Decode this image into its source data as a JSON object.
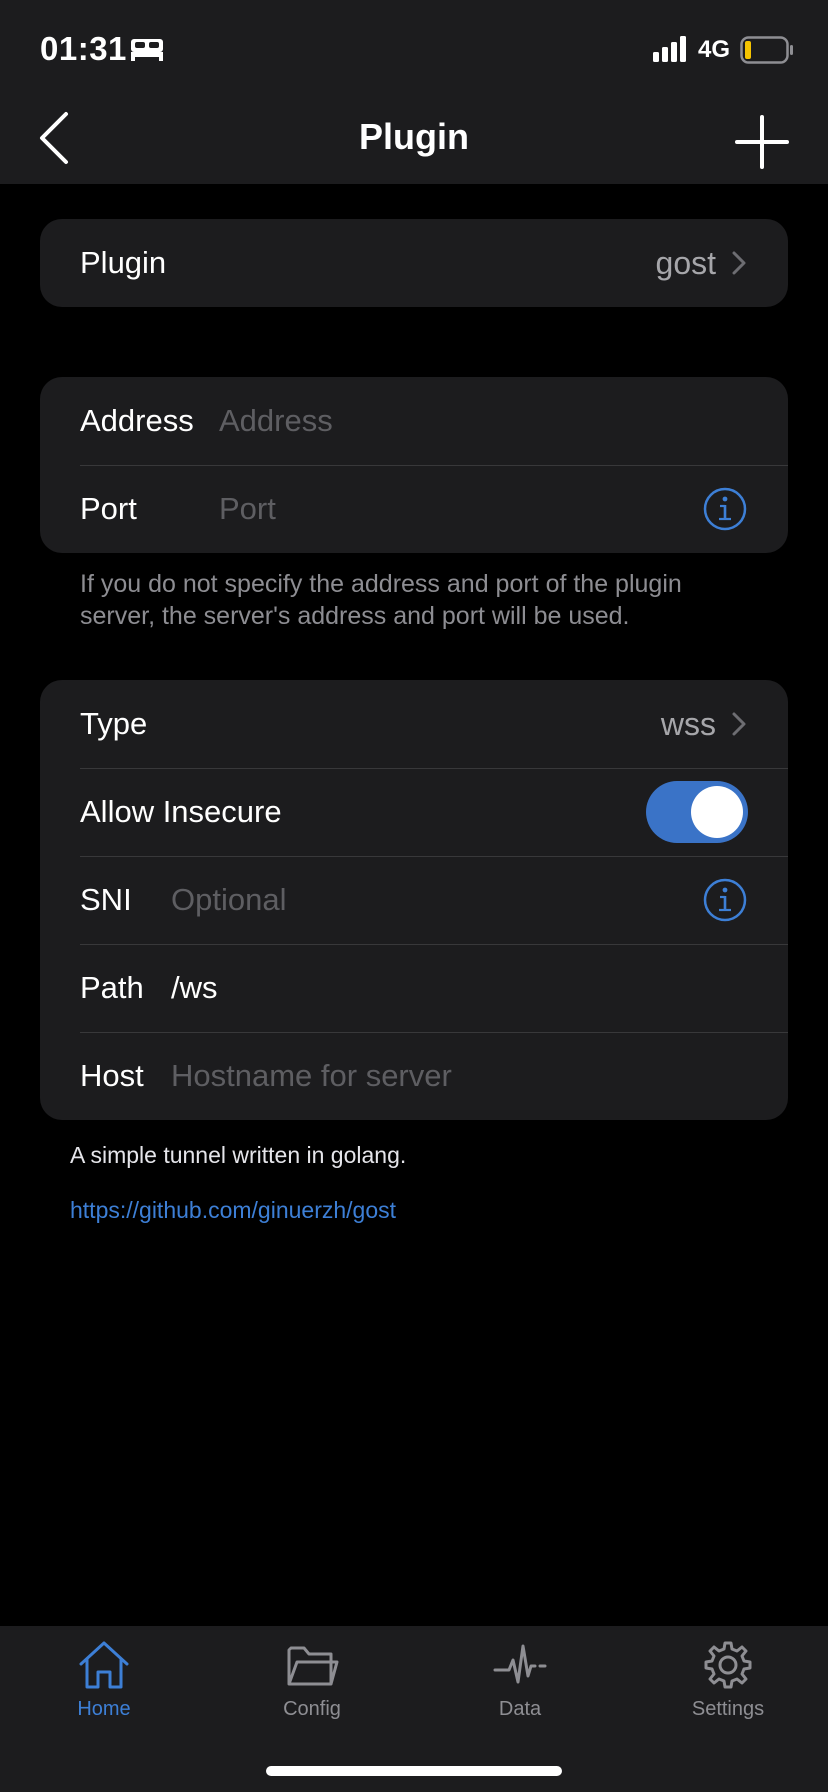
{
  "status_bar": {
    "time": "01:31",
    "network": "4G"
  },
  "nav": {
    "title": "Plugin"
  },
  "plugin_group": {
    "label": "Plugin",
    "value": "gost"
  },
  "server_group": {
    "address_label": "Address",
    "address_placeholder": "Address",
    "port_label": "Port",
    "port_placeholder": "Port",
    "footnote": "If you do not specify the address and port of the plugin server, the server's address and port will be used."
  },
  "options_group": {
    "type_label": "Type",
    "type_value": "wss",
    "allow_insecure_label": "Allow Insecure",
    "allow_insecure_enabled": true,
    "sni_label": "SNI",
    "sni_placeholder": "Optional",
    "path_label": "Path",
    "path_value": "/ws",
    "host_label": "Host",
    "host_placeholder": "Hostname for server"
  },
  "description": "A simple tunnel written in golang.",
  "link": "https://github.com/ginuerzh/gost",
  "tabs": [
    {
      "label": "Home",
      "icon": "home-icon",
      "active": true
    },
    {
      "label": "Config",
      "icon": "folder-icon",
      "active": false
    },
    {
      "label": "Data",
      "icon": "activity-icon",
      "active": false
    },
    {
      "label": "Settings",
      "icon": "gear-icon",
      "active": false
    }
  ],
  "colors": {
    "accent": "#3d7fd6",
    "toggle_on": "#3a73c7",
    "surface": "#1c1c1e",
    "background": "#000000"
  }
}
